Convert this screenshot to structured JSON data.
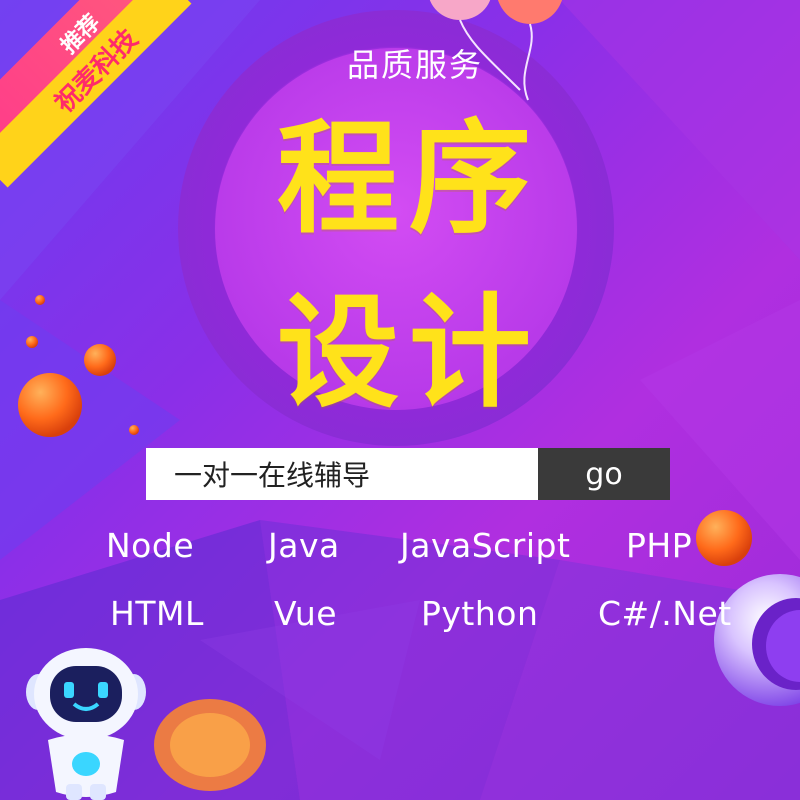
{
  "badge": {
    "top_label": "推荐",
    "main_label": "祝麦科技"
  },
  "header": {
    "subtitle": "品质服务"
  },
  "title": {
    "line1": "程序",
    "line2": "设计"
  },
  "search": {
    "value": "一对一在线辅导",
    "button_label": "go"
  },
  "tags": {
    "row1": [
      "Node",
      "Java",
      "JavaScript",
      "PHP"
    ],
    "row2": [
      "HTML",
      "Vue",
      "Python",
      "C#/.Net"
    ]
  },
  "colors": {
    "background": "#8a2fe8",
    "title": "#ffe21a",
    "button": "#3a3a3a",
    "badge_yellow": "#ffd31a",
    "badge_pink": "#ff3c8a"
  },
  "icons": [
    "robot-mascot-icon",
    "balloon-icon",
    "orange-sphere-icon",
    "purple-sphere-icon"
  ]
}
